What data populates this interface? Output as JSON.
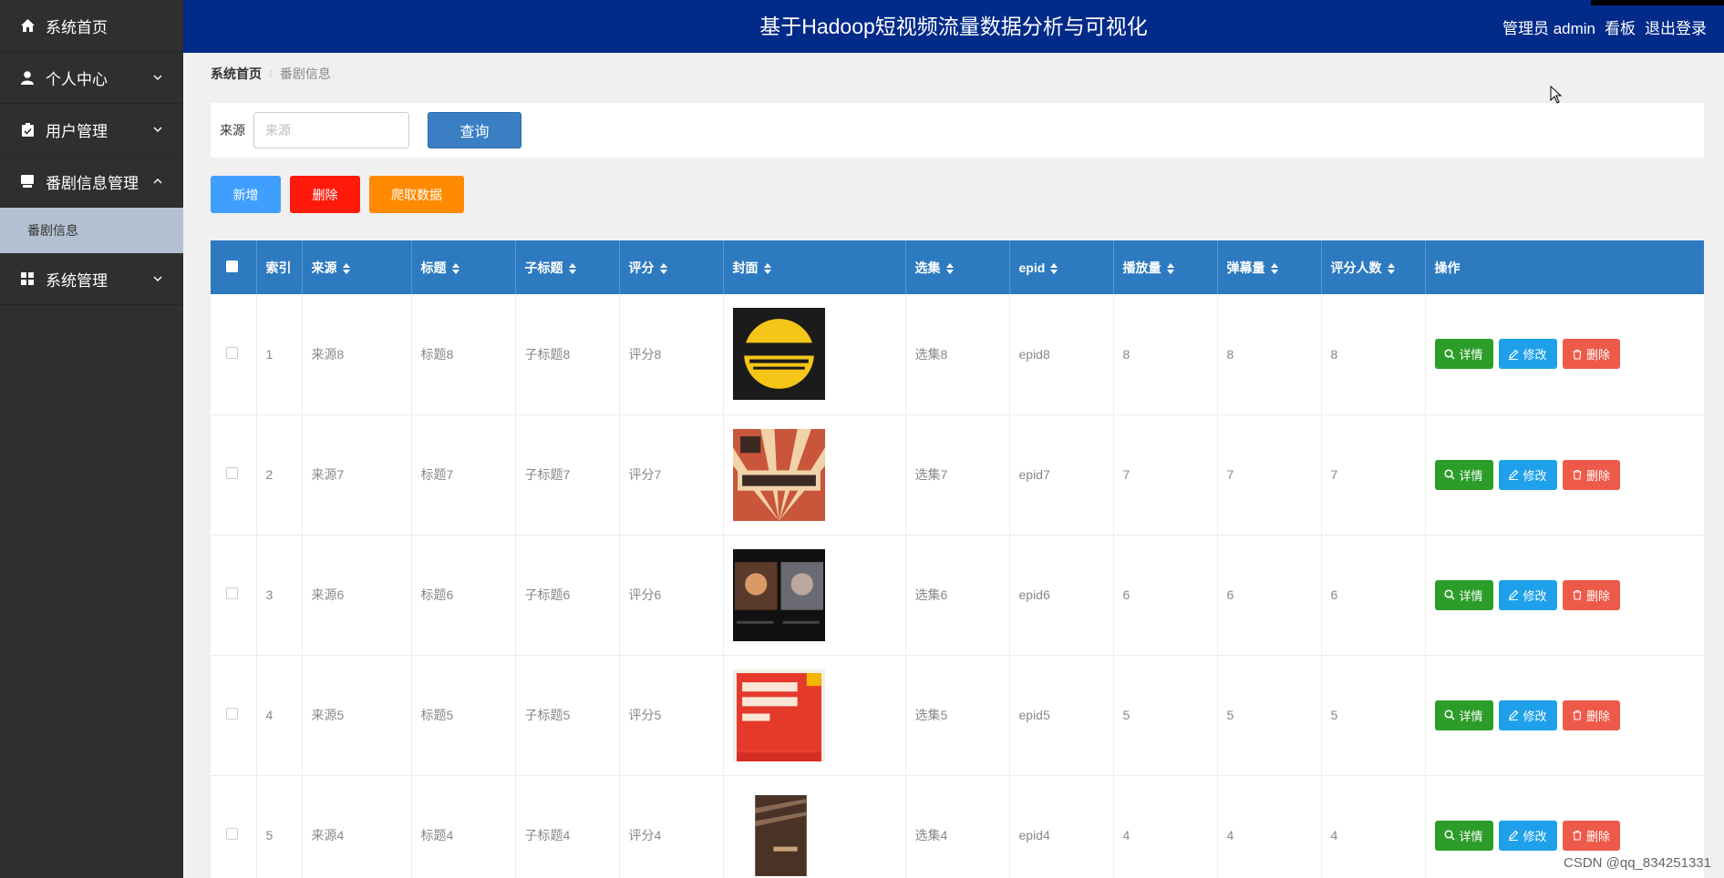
{
  "app": {
    "title": "基于Hadoop短视频流量数据分析与可视化",
    "user_label": "管理员 admin",
    "dashboard_link": "看板",
    "logout_link": "退出登录"
  },
  "sidebar": {
    "items": [
      {
        "label": "系统首页",
        "icon": "home-icon"
      },
      {
        "label": "个人中心",
        "icon": "person-icon"
      },
      {
        "label": "用户管理",
        "icon": "clipboard-icon"
      },
      {
        "label": "番剧信息管理",
        "icon": "monitor-icon",
        "expanded": true
      },
      {
        "label": "系统管理",
        "icon": "grid-icon"
      }
    ],
    "sub_item": "番剧信息"
  },
  "breadcrumb": {
    "home": "系统首页",
    "separator": "⁝",
    "current": "番剧信息"
  },
  "search": {
    "label": "来源",
    "placeholder": "来源",
    "value": "",
    "button": "查询"
  },
  "actions": {
    "add": "新增",
    "delete": "删除",
    "crawl": "爬取数据"
  },
  "table": {
    "headers": [
      "索引",
      "来源",
      "标题",
      "子标题",
      "评分",
      "封面",
      "选集",
      "epid",
      "播放量",
      "弹幕量",
      "评分人数",
      "操作"
    ],
    "op_labels": {
      "detail": "详情",
      "edit": "修改",
      "remove": "删除"
    },
    "rows": [
      {
        "index": "1",
        "source": "来源8",
        "title": "标题8",
        "subtitle": "子标题8",
        "rating": "评分8",
        "cover": "book-cover-jianying",
        "episode": "选集8",
        "epid": "epid8",
        "plays": "8",
        "danmaku": "8",
        "raters": "8"
      },
      {
        "index": "2",
        "source": "来源7",
        "title": "标题7",
        "subtitle": "子标题7",
        "rating": "评分7",
        "cover": "book-cover-video-production",
        "episode": "选集7",
        "epid": "epid7",
        "plays": "7",
        "danmaku": "7",
        "raters": "7"
      },
      {
        "index": "3",
        "source": "来源6",
        "title": "标题6",
        "subtitle": "子标题6",
        "rating": "评分6",
        "cover": "cartoon-screens",
        "episode": "选集6",
        "epid": "epid6",
        "plays": "6",
        "danmaku": "6",
        "raters": "6"
      },
      {
        "index": "4",
        "source": "来源5",
        "title": "标题5",
        "subtitle": "子标题5",
        "rating": "评分5",
        "cover": "book-cover-short-video",
        "episode": "选集5",
        "epid": "epid5",
        "plays": "5",
        "danmaku": "5",
        "raters": "5"
      },
      {
        "index": "5",
        "source": "来源4",
        "title": "标题4",
        "subtitle": "子标题4",
        "rating": "评分4",
        "cover": "dark-book-cover",
        "episode": "选集4",
        "epid": "epid4",
        "plays": "4",
        "danmaku": "4",
        "raters": "4"
      }
    ]
  },
  "watermark": "CSDN @qq_834251331",
  "colors": {
    "header_bg": "#012a89",
    "sidebar_bg": "#2f2f2f",
    "table_header_bg": "#2d7ac1",
    "btn_add": "#409eff",
    "btn_delete": "#ff1a0c",
    "btn_crawl": "#ff8a00",
    "op_detail": "#2d9d2a",
    "op_edit": "#1ea1ea",
    "op_remove": "#ee5a4a"
  }
}
